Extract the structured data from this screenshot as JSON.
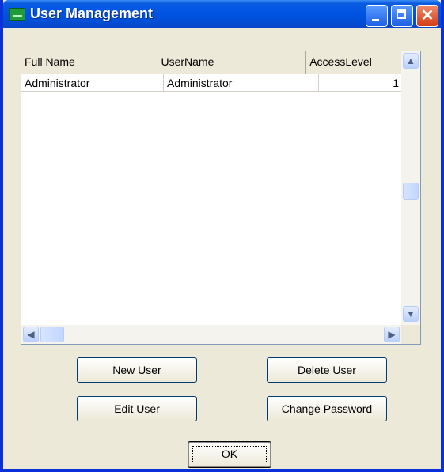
{
  "window": {
    "title": "User Management"
  },
  "title_buttons": {
    "close_glyph": "✕"
  },
  "table": {
    "columns": [
      "Full Name",
      "UserName",
      "AccessLevel"
    ],
    "rows": [
      {
        "full_name": "Administrator",
        "username": "Administrator",
        "access_level": "1"
      }
    ]
  },
  "buttons": {
    "new_user": "New User",
    "delete_user": "Delete User",
    "edit_user": "Edit User",
    "change_password": "Change Password",
    "ok": "OK"
  },
  "scroll_glyphs": {
    "up": "▲",
    "down": "▼",
    "left": "◀",
    "right": "▶"
  },
  "colors": {
    "titlebar": "#0054e3",
    "face": "#ece9d8",
    "border": "#0831d9"
  }
}
